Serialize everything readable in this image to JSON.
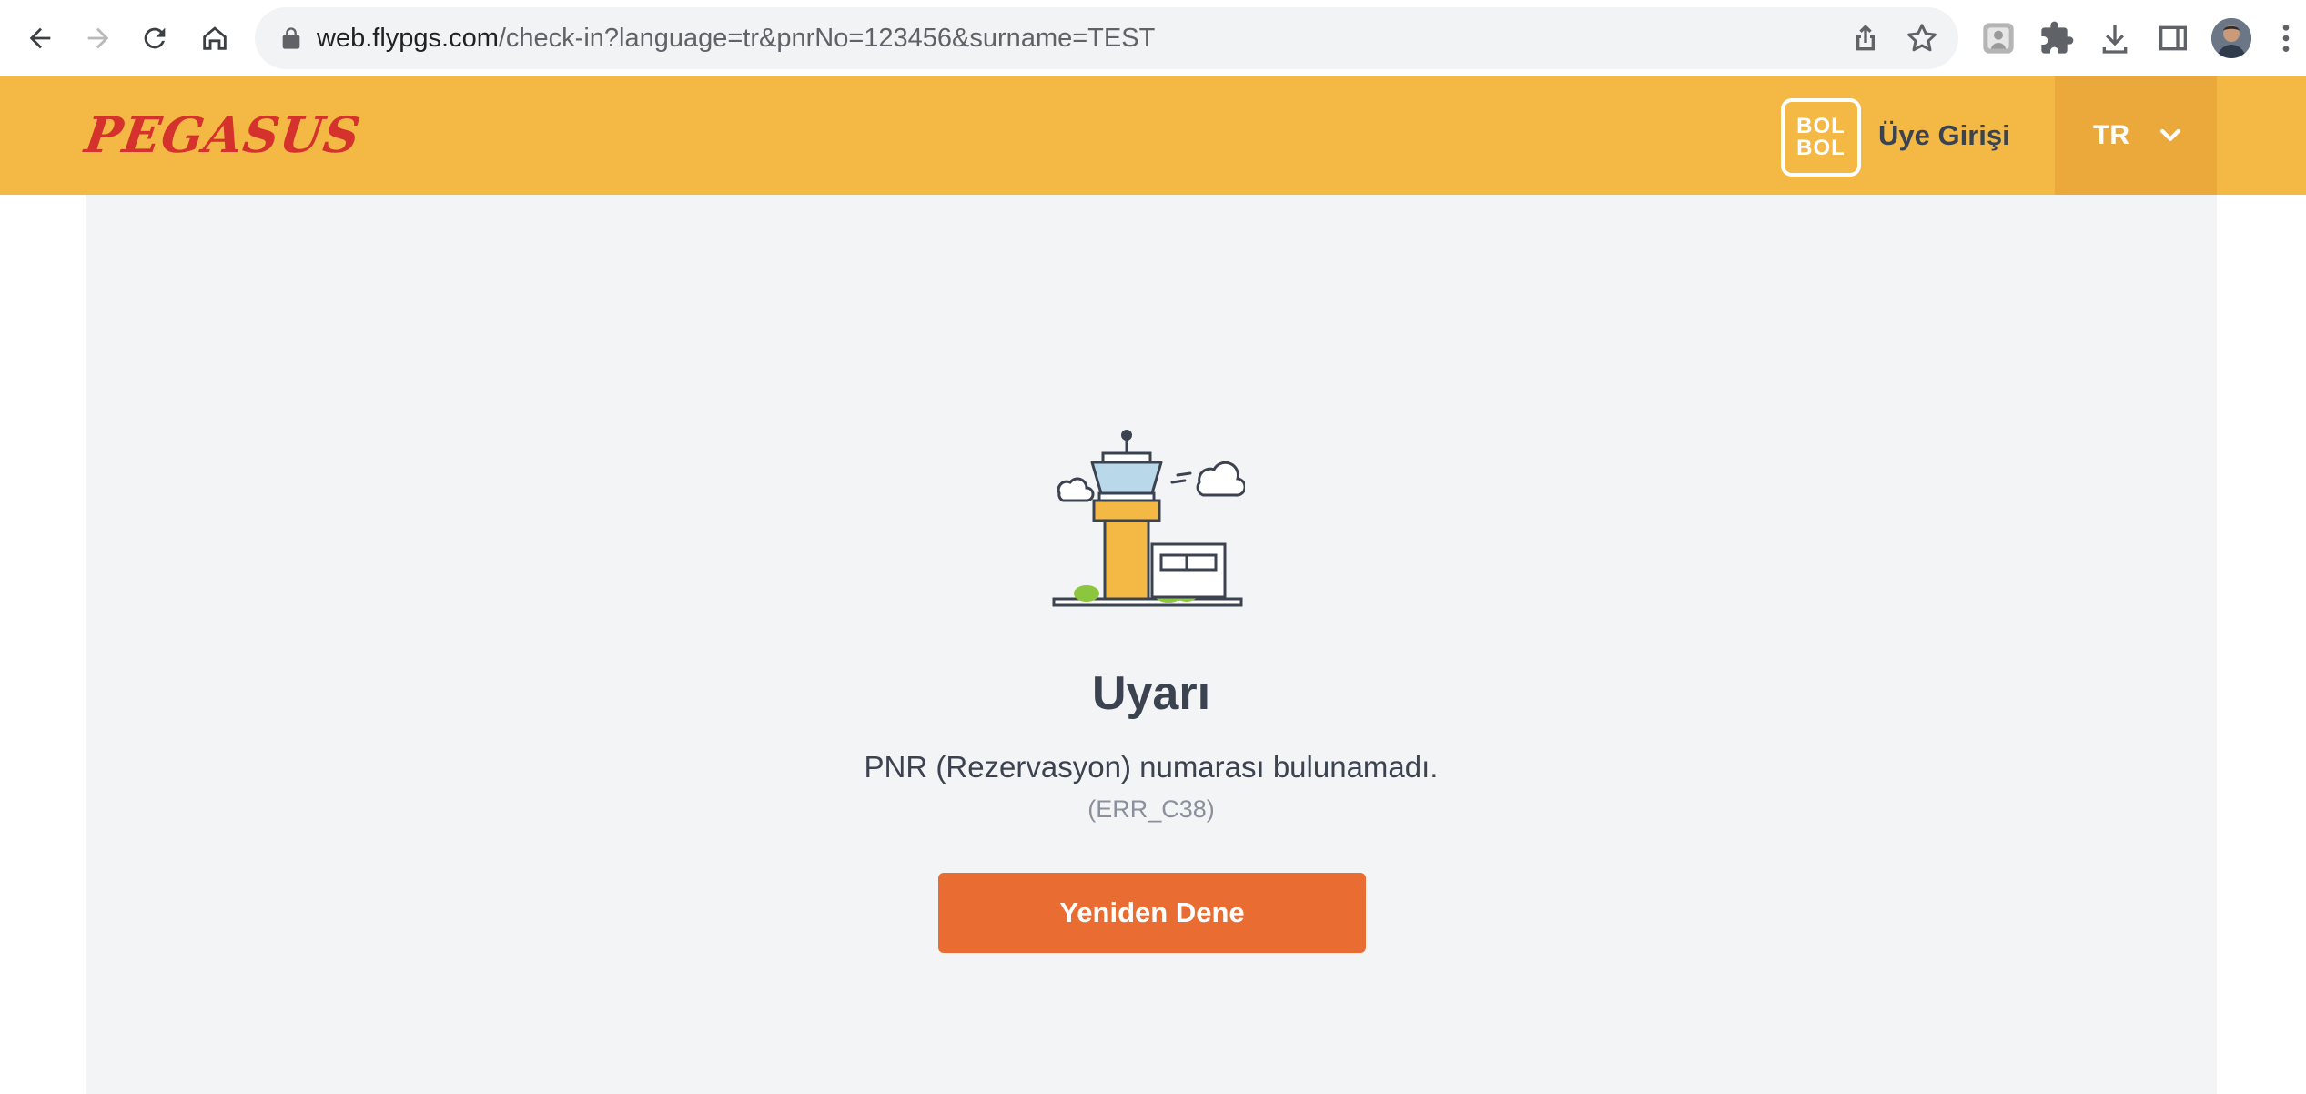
{
  "browser": {
    "url_host": "web.flypgs.com",
    "url_path": "/check-in?language=tr&pnrNo=123456&surname=TEST",
    "icons": [
      "back-icon",
      "forward-icon",
      "reload-icon",
      "home-icon",
      "lock-icon",
      "share-icon",
      "star-icon",
      "profile-extension-icon",
      "puzzle-icon",
      "download-icon",
      "side-panel-icon",
      "avatar",
      "menu-icon"
    ]
  },
  "header": {
    "logo_text": "PEGASUS",
    "bolbol_line1": "BOL",
    "bolbol_line2": "BOL",
    "login_label": "Üye Girişi",
    "language": "TR",
    "colors": {
      "header_bg": "#f3b944",
      "lang_bg": "#eaa93a",
      "logo": "#d6322d"
    }
  },
  "main": {
    "illustration": "control-tower-illustration",
    "title": "Uyarı",
    "message": "PNR (Rezervasyon) numarası bulunamadı.",
    "error_code": "(ERR_C38)",
    "retry_label": "Yeniden Dene",
    "colors": {
      "panel_bg": "#f3f4f6",
      "button_bg": "#e96d32"
    }
  }
}
